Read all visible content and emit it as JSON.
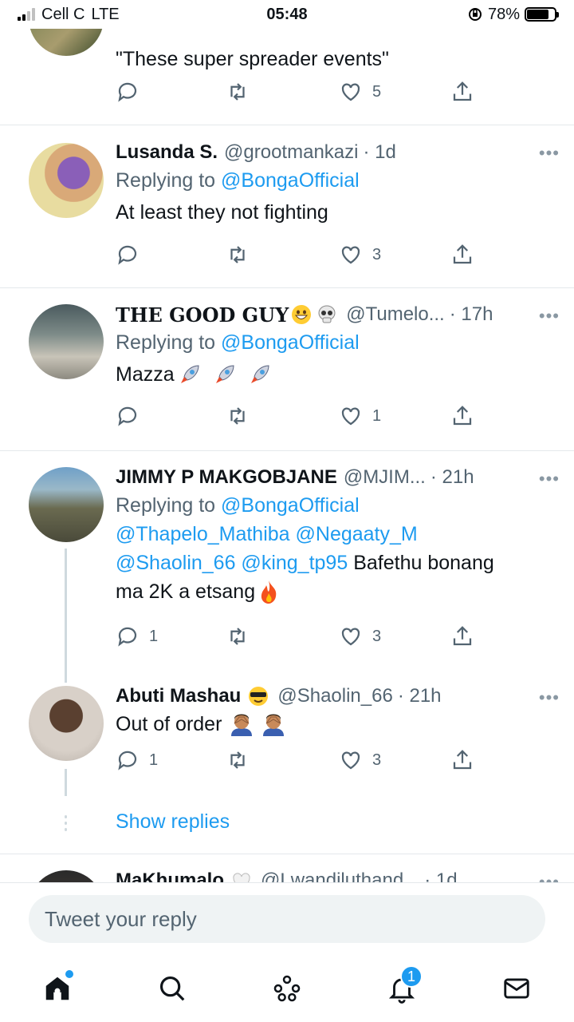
{
  "status_bar": {
    "carrier": "Cell C",
    "network": "LTE",
    "time": "05:48",
    "battery_percent": "78%",
    "battery_level": 0.78
  },
  "tweets": [
    {
      "text": "\"These super spreader events\"",
      "counts": {
        "reply": "",
        "retweet": "",
        "like": "5"
      }
    },
    {
      "name": "Lusanda S.",
      "handle": "@grootmankazi",
      "time": "· 1d",
      "replying_label": "Replying to",
      "replying_handle": "@BongaOfficial",
      "text": "At least they not fighting",
      "counts": {
        "reply": "",
        "retweet": "",
        "like": "3"
      }
    },
    {
      "name": "THE GOOD GUY",
      "handle": "@Tumelo...",
      "time": "· 17h",
      "replying_label": "Replying to",
      "replying_handle": "@BongaOfficial",
      "text": "Mazza",
      "counts": {
        "reply": "",
        "retweet": "",
        "like": "1"
      }
    },
    {
      "name": "JIMMY P MAKGOBJANE",
      "handle": "@MJIM...",
      "time": "· 21h",
      "replying_label": "Replying to",
      "replying_handle": "@BongaOfficial",
      "mentions_line1": "@Thapelo_Mathiba @Negaaty_M",
      "mentions_line2": "@Shaolin_66 @king_tp95",
      "text_tail": "Bafethu bonang",
      "text_line3": "ma 2K a etsang",
      "counts": {
        "reply": "1",
        "retweet": "",
        "like": "3"
      }
    },
    {
      "name": "Abuti Mashau",
      "handle": "@Shaolin_66",
      "time": "· 21h",
      "text": "Out of order",
      "counts": {
        "reply": "1",
        "retweet": "",
        "like": "3"
      }
    },
    {
      "name": "MaKhumalo",
      "handle": "@Lwandiluthand...",
      "time": "· 1d"
    }
  ],
  "show_replies": "Show replies",
  "more_label": "•••",
  "reply_bar": {
    "placeholder": "Tweet your reply"
  },
  "tab_bar": {
    "notifications_count": "1"
  },
  "colors": {
    "accent": "#1d9bf0",
    "secondary_text": "#536471",
    "divider": "#e4e8eb"
  }
}
